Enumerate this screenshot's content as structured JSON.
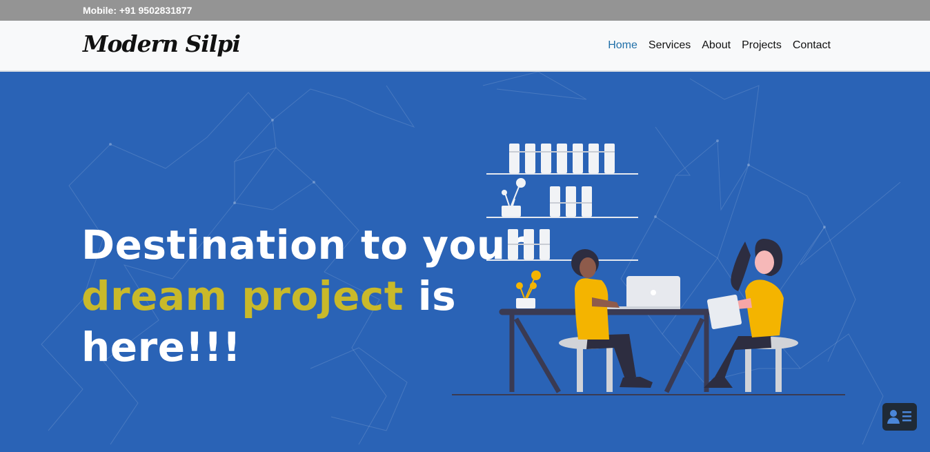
{
  "topbar": {
    "mobile": "Mobile: +91 9502831877"
  },
  "navbar": {
    "brand": "Modern Silpi",
    "links": [
      {
        "label": "Home",
        "active": true
      },
      {
        "label": "Services",
        "active": false
      },
      {
        "label": "About",
        "active": false
      },
      {
        "label": "Projects",
        "active": false
      },
      {
        "label": "Contact",
        "active": false
      }
    ]
  },
  "hero": {
    "line1": "Destination to your",
    "accent": "dream project",
    "after_accent": " is",
    "line3": "here!!!",
    "illustration": "two-people-working-at-desk-illustration"
  },
  "fab": {
    "icon": "contact-card-icon"
  },
  "colors": {
    "topbar_bg": "#949494",
    "navbar_bg": "#f8f9fa",
    "active_link": "#1f6fa8",
    "hero_bg": "#2a63b6",
    "accent_text": "#c9b92a",
    "person_shirt": "#f4b400",
    "fab_bg": "#1f2a36"
  }
}
